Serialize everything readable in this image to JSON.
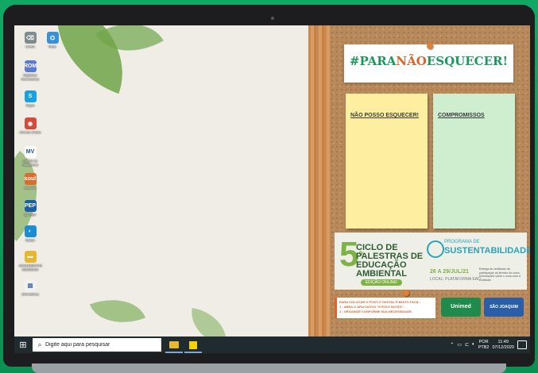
{
  "desktop_icons": [
    {
      "label": "Lixeira",
      "icon": "trash-icon",
      "color": "#7f8c8d",
      "glyph": "⌫"
    },
    {
      "label": "Rede",
      "icon": "network-icon",
      "color": "#3b8fd6",
      "glyph": "⌬"
    },
    {
      "label": "Digitalizar Documentos",
      "icon": "scanner-icon",
      "color": "#5b7bd3",
      "glyph": "ROM"
    },
    {
      "label": "Skype",
      "icon": "skype-icon",
      "color": "#1aa1e0",
      "glyph": "S"
    },
    {
      "label": "Chrome Online",
      "icon": "chrome-icon",
      "color": "#d64a3a",
      "glyph": "◉"
    },
    {
      "label": "Gestão de Resultados",
      "icon": "mv-icon",
      "color": "#ffffff",
      "glyph": "MV"
    },
    {
      "label": "Soul MV",
      "icon": "soul-icon",
      "color": "#e06a2a",
      "glyph": "soul"
    },
    {
      "label": "MV PEP",
      "icon": "pep-icon",
      "color": "#1b5fa8",
      "glyph": "PEP"
    },
    {
      "label": "Sislam",
      "icon": "sislam-icon",
      "color": "#1a8ed0",
      "glyph": "◐"
    },
    {
      "label": "DOCUMENTOS SEMANAIS",
      "icon": "folder-icon",
      "color": "#e8b730",
      "glyph": "▬"
    },
    {
      "label": "Informativos",
      "icon": "document-icon",
      "color": "#f1f1f1",
      "glyph": "▤"
    }
  ],
  "board": {
    "title_prefix": "#PARA",
    "title_mid": "NÃO",
    "title_suffix": "ESQUECER!",
    "note_left": "NÃO POSSO ESQUECER!",
    "note_right": "COMPROMISSOS"
  },
  "banner": {
    "number": "5",
    "ordinal": "º",
    "ciclo": "CICLO DE PALESTRAS DE EDUCAÇÃO AMBIENTAL",
    "edition": "EDIÇÃO ONLINE!",
    "program_label": "PROGRAMA DE",
    "program_name": "SUSTENTABILIDADE",
    "dates": "26 A 29/JUL/21",
    "local": "LOCAL: PLATAFORMA EAD",
    "info": "Entrega de certificado de participação ao término do curso. Informações sobre o curso com a comissão"
  },
  "hint": {
    "line1": "PARA COLOCAR O POST-IT DIGITAL É MUITO FÁCIL:",
    "line2": "1 - ABRA O APLICATIVO \"STICKY NOTES\".",
    "line3": "2 - ORGANIZE CONFORME SUA NECESSIDADE."
  },
  "logos": {
    "unimed": "Unimed",
    "sao_joaquim": "SÃO JOAQUIM"
  },
  "taskbar": {
    "search_placeholder": "Digite aqui para pesquisar",
    "lang_top": "POR",
    "lang_bottom": "PTB2",
    "time": "11:49",
    "date": "07/12/2020"
  },
  "colors": {
    "accent_green": "#1a9a5a",
    "accent_orange": "#e0622a",
    "taskbar": "#1f2b2e"
  }
}
